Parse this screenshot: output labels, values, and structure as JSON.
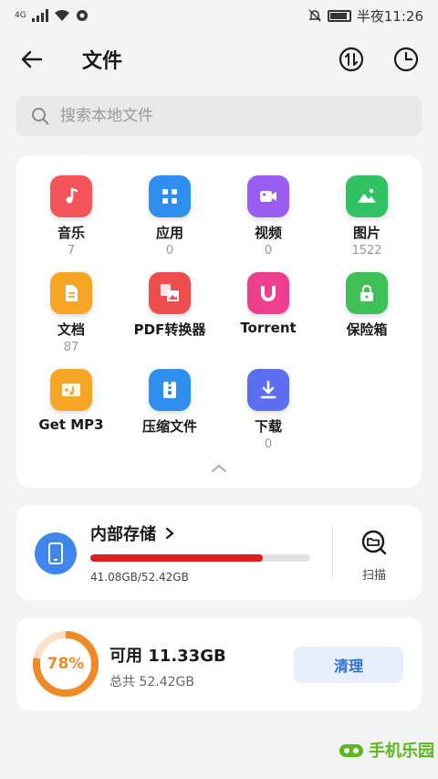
{
  "status_bar": {
    "network": "4G",
    "time": "半夜11:26"
  },
  "header": {
    "title": "文件"
  },
  "search": {
    "placeholder": "搜索本地文件"
  },
  "categories": [
    {
      "label": "音乐",
      "count": "7",
      "icon": "music-icon",
      "color": "#f4555a"
    },
    {
      "label": "应用",
      "count": "0",
      "icon": "apps-icon",
      "color": "#2f8ff0"
    },
    {
      "label": "视频",
      "count": "0",
      "icon": "video-icon",
      "color": "#9b5cf0"
    },
    {
      "label": "图片",
      "count": "1522",
      "icon": "image-icon",
      "color": "#2fc162"
    },
    {
      "label": "文档",
      "count": "87",
      "icon": "document-icon",
      "color": "#f6a623"
    },
    {
      "label": "PDF转换器",
      "count": "",
      "icon": "pdf-converter-icon",
      "color": "#ee4d4d"
    },
    {
      "label": "Torrent",
      "count": "",
      "icon": "torrent-magnet-icon",
      "color": "#ee3f8e"
    },
    {
      "label": "保险箱",
      "count": "",
      "icon": "lock-icon",
      "color": "#3fc158"
    },
    {
      "label": "Get MP3",
      "count": "",
      "icon": "mp3-icon",
      "color": "#f6a623"
    },
    {
      "label": "压缩文件",
      "count": "",
      "icon": "zip-icon",
      "color": "#2f8ff0"
    },
    {
      "label": "下载",
      "count": "0",
      "icon": "download-icon",
      "color": "#5b6ff0"
    }
  ],
  "storage": {
    "title": "内部存储",
    "used_text": "41.08GB/52.42GB",
    "used_fraction": 0.784,
    "scan_label": "扫描"
  },
  "free": {
    "percent_text": "78%",
    "percent": 78,
    "title": "可用 11.33GB",
    "total": "总共 52.42GB",
    "clean_label": "清理"
  },
  "watermark": {
    "text": "手机乐园"
  },
  "colors": {
    "accent_blue": "#2d6fd6",
    "bar_red": "#e01e1e",
    "ring_orange": "#f08a24"
  }
}
